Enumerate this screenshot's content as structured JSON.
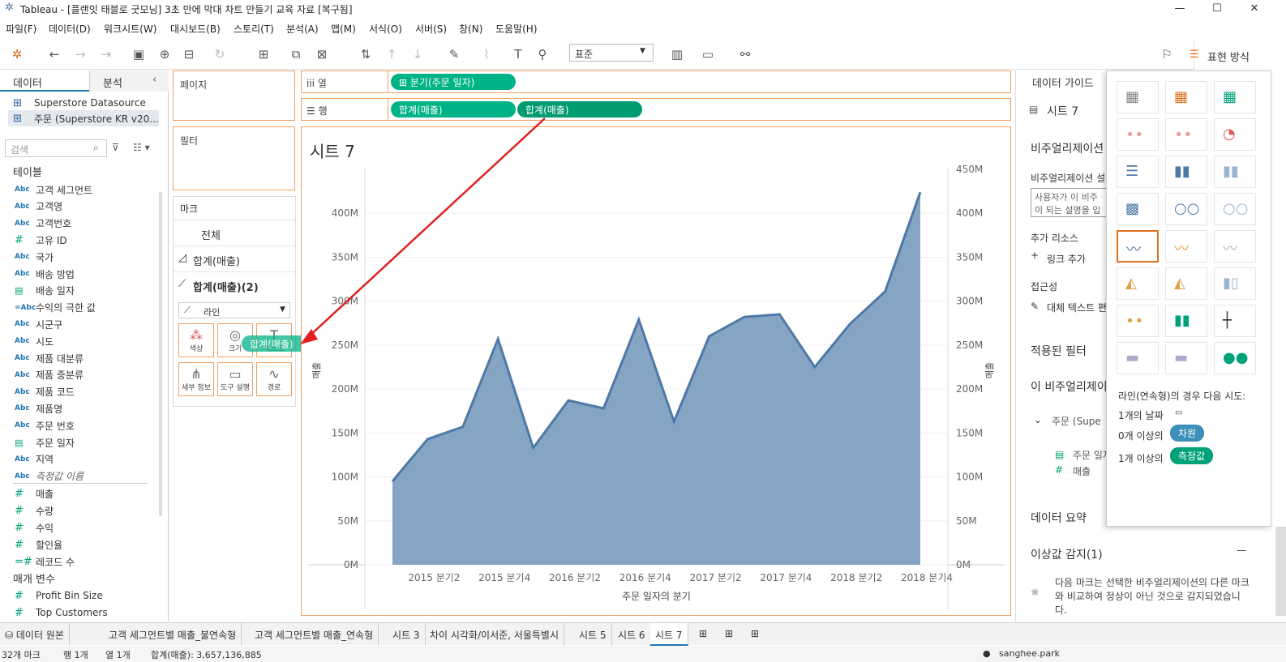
{
  "window": {
    "title": "Tableau - [플랜잇 태블로 굿모닝] 3초 만에 막대 차트 만들기 교육 자료 [복구됨]"
  },
  "menu": [
    "파일(F)",
    "데이터(D)",
    "워크시트(W)",
    "대시보드(B)",
    "스토리(T)",
    "분석(A)",
    "맵(M)",
    "서식(O)",
    "서버(S)",
    "창(N)",
    "도움말(H)"
  ],
  "toolbar": {
    "fit": "표준",
    "showme": "표현 방식"
  },
  "left": {
    "tabs": [
      "데이터",
      "분석"
    ],
    "sources": [
      "Superstore Datasource",
      "주문 (Superstore KR v20..."
    ],
    "search_placeholder": "검색",
    "tables_label": "테이블",
    "fields": [
      {
        "type": "Abc",
        "name": "고객 세그먼트"
      },
      {
        "type": "Abc",
        "name": "고객명"
      },
      {
        "type": "Abc",
        "name": "고객번호"
      },
      {
        "type": "#",
        "name": "고유 ID"
      },
      {
        "type": "Abc",
        "name": "국가"
      },
      {
        "type": "Abc",
        "name": "배송 방법"
      },
      {
        "type": "date",
        "name": "배송 일자"
      },
      {
        "type": "=Abc",
        "name": "수익의 극한 값"
      },
      {
        "type": "Abc",
        "name": "시군구"
      },
      {
        "type": "Abc",
        "name": "시도"
      },
      {
        "type": "Abc",
        "name": "제품 대분류"
      },
      {
        "type": "Abc",
        "name": "제품 중분류"
      },
      {
        "type": "Abc",
        "name": "제품 코드"
      },
      {
        "type": "Abc",
        "name": "제품명"
      },
      {
        "type": "Abc",
        "name": "주문 번호"
      },
      {
        "type": "date",
        "name": "주문 일자"
      },
      {
        "type": "Abc",
        "name": "지역"
      },
      {
        "type": "Abc",
        "name": "측정값 이름"
      }
    ],
    "measures": [
      {
        "type": "#",
        "name": "매출"
      },
      {
        "type": "#",
        "name": "수량"
      },
      {
        "type": "#",
        "name": "수익"
      },
      {
        "type": "#",
        "name": "할인율"
      },
      {
        "type": "=#",
        "name": "레코드 수"
      }
    ],
    "params_label": "매개 변수",
    "params": [
      {
        "type": "#",
        "name": "Profit Bin Size"
      },
      {
        "type": "#",
        "name": "Top Customers"
      }
    ]
  },
  "shelves": {
    "pages": "페이지",
    "filters": "필터",
    "columns_label": "열",
    "rows_label": "행",
    "col_pill": "분기(주문 일자)",
    "row_pills": [
      "합계(매출)",
      "합계(매출)"
    ]
  },
  "marks": {
    "title": "마크",
    "all": "전체",
    "card1": "합계(매출)",
    "card2": "합계(매출)(2)",
    "type": "라인",
    "buttons": [
      "색상",
      "크기",
      "텍스트",
      "세부 정보",
      "도구 설명",
      "경로"
    ],
    "drag_pill": "합계(매출)"
  },
  "sheet": {
    "title": "시트 7"
  },
  "chart_data": {
    "type": "area",
    "title": "시트 7",
    "xlabel": "주문 일자의 분기",
    "x": [
      "2015 분기1",
      "2015 분기2",
      "2015 분기3",
      "2015 분기4",
      "2016 분기1",
      "2016 분기2",
      "2016 분기3",
      "2016 분기4",
      "2017 분기1",
      "2017 분기2",
      "2017 분기3",
      "2017 분기4",
      "2018 분기1",
      "2018 분기2",
      "2018 분기3",
      "2018 분기4"
    ],
    "xtick_labels": [
      "2015 분기2",
      "2015 분기4",
      "2016 분기2",
      "2016 분기4",
      "2017 분기2",
      "2017 분기4",
      "2018 분기2",
      "2018 분기4"
    ],
    "values": [
      95,
      143,
      157,
      257,
      133,
      187,
      178,
      279,
      163,
      260,
      282,
      285,
      225,
      274,
      311,
      424
    ],
    "unit": "M",
    "ylim": [
      0,
      450
    ],
    "left_ticks": [
      "0M",
      "50M",
      "100M",
      "150M",
      "200M",
      "250M",
      "300M",
      "350M",
      "400M"
    ],
    "right_ticks": [
      "0M",
      "50M",
      "100M",
      "150M",
      "200M",
      "250M",
      "300M",
      "350M",
      "400M",
      "450M"
    ],
    "axis_label_left": "매출",
    "axis_label_right": "매출",
    "color": "#86a4c3",
    "line_color": "#4e79a7"
  },
  "guide": {
    "title": "데이터 가이드",
    "sheet": "시트 7",
    "viz_desc": "비주얼리제이션",
    "viz_desc_label": "비주얼리제이션 설",
    "viz_placeholder": "사용자가 이 비주 이 되는 설명을 입",
    "resources": "추가 리소스",
    "add_link": "링크 추가",
    "access": "접근성",
    "alt_text": "대체 텍스트 편",
    "applied_filters": "적용된 필터",
    "this_viz": "이 비주얼리제이",
    "source": "주문 (Supe",
    "f1": "주문 일자",
    "f2": "매출",
    "summary": "데이터 요약",
    "outlier": "이상값 감지(1)",
    "outlier_desc": "다음 마크는 선택한 비주얼리제이션의 다른 마크와 비교하여 정상이 아닌 것으로 감지되었습니다."
  },
  "showme": {
    "hint": "라인(연속형)의 경우 다음 시도:",
    "r1": "1개의 날짜",
    "r2a": "0개 이상의",
    "r2b": "차원",
    "r3a": "1개 이상의",
    "r3b": "측정값"
  },
  "tabs": [
    "데이터 원본",
    "고객 세그먼트별 매출_불연속형",
    "고객 세그먼트별 매출_연속형",
    "시트 3",
    "차이 시각화/이서준, 서울특별시",
    "시트 5",
    "시트 6",
    "시트 7"
  ],
  "status": {
    "left": "32개 마크",
    "rows": "행 1개",
    "cols": "열 1개",
    "sum": "합계(매출): 3,657,136,885",
    "user": "sanghee.park"
  }
}
